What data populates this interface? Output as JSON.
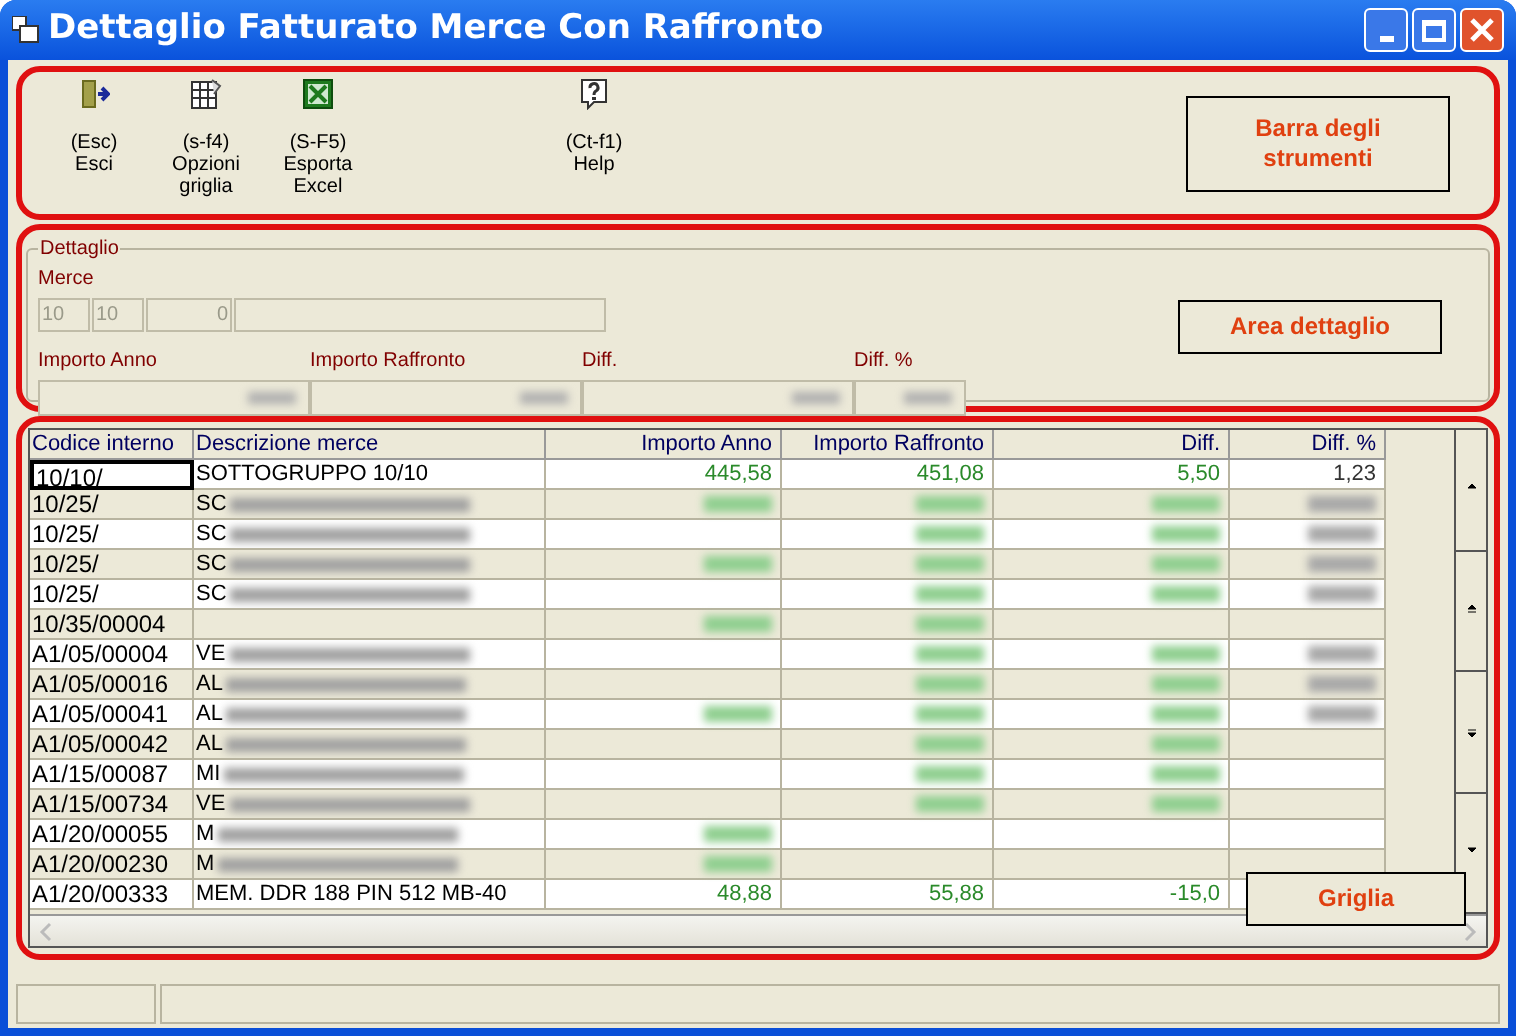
{
  "window": {
    "title": "Dettaglio Fatturato Merce Con Raffronto"
  },
  "toolbar": {
    "buttons": [
      {
        "kind": "exit",
        "shortcut": "(Esc)",
        "label": "Esci"
      },
      {
        "kind": "grid",
        "shortcut": "(s-f4)",
        "label": "Opzioni griglia"
      },
      {
        "kind": "excel",
        "shortcut": "(S-F5)",
        "label": "Esporta Excel"
      },
      {
        "kind": "help",
        "shortcut": "(Ct-f1)",
        "label": "Help"
      }
    ],
    "callout": "Barra degli strumenti"
  },
  "detail": {
    "title": "Dettaglio",
    "merce_label": "Merce",
    "merce_fields": [
      "10",
      "10",
      "0"
    ],
    "fields": [
      {
        "label": "Importo Anno",
        "blurred": true
      },
      {
        "label": "Importo Raffronto",
        "blurred": true
      },
      {
        "label": "Diff.",
        "blurred": true
      },
      {
        "label": "Diff. %",
        "blurred": true
      }
    ],
    "callout": "Area dettaglio"
  },
  "grid": {
    "columns": [
      "Codice interno",
      "Descrizione merce",
      "Importo Anno",
      "Importo Raffronto",
      "Diff.",
      "Diff. %"
    ],
    "rows": [
      {
        "selected": true,
        "code": "10/10/",
        "desc": "SOTTOGRUPPO 10/10",
        "desc_blurred": false,
        "values": [
          {
            "text": "445,58",
            "blurred": false
          },
          {
            "text": "451,08",
            "blurred": false
          },
          {
            "text": "5,50",
            "blurred": false
          },
          {
            "text": "1,23",
            "blurred": false
          }
        ]
      },
      {
        "selected": false,
        "code": "10/25/",
        "desc": "SC",
        "desc_blurred": true,
        "values": [
          {
            "blurred": true
          },
          {
            "blurred": true
          },
          {
            "blurred": true
          },
          {
            "blurred": true
          }
        ]
      },
      {
        "selected": false,
        "code": "10/25/",
        "desc": "SC",
        "desc_blurred": true,
        "values": [
          {
            "blurred": false
          },
          {
            "blurred": true
          },
          {
            "blurred": true
          },
          {
            "blurred": true
          }
        ]
      },
      {
        "selected": false,
        "code": "10/25/",
        "desc": "SC",
        "desc_blurred": true,
        "values": [
          {
            "blurred": true
          },
          {
            "blurred": true
          },
          {
            "blurred": true
          },
          {
            "blurred": true
          }
        ]
      },
      {
        "selected": false,
        "code": "10/25/",
        "desc": "SC",
        "desc_blurred": true,
        "values": [
          {
            "blurred": false
          },
          {
            "blurred": true
          },
          {
            "blurred": true
          },
          {
            "blurred": true
          }
        ]
      },
      {
        "selected": false,
        "code": "10/35/00004",
        "desc_blurred": false,
        "values": [
          {
            "blurred": true
          },
          {
            "blurred": true
          },
          {
            "blurred": false
          },
          {
            "blurred": false
          }
        ]
      },
      {
        "selected": false,
        "code": "A1/05/00004",
        "desc": "VE",
        "desc_blurred": true,
        "values": [
          {
            "blurred": false
          },
          {
            "blurred": true
          },
          {
            "blurred": true
          },
          {
            "blurred": true
          }
        ]
      },
      {
        "selected": false,
        "code": "A1/05/00016",
        "desc": "AL",
        "desc_blurred": true,
        "values": [
          {
            "blurred": false
          },
          {
            "blurred": true
          },
          {
            "blurred": true
          },
          {
            "blurred": true
          }
        ]
      },
      {
        "selected": false,
        "code": "A1/05/00041",
        "desc": "AL",
        "desc_blurred": true,
        "values": [
          {
            "blurred": true
          },
          {
            "blurred": true
          },
          {
            "blurred": true
          },
          {
            "blurred": true
          }
        ]
      },
      {
        "selected": false,
        "code": "A1/05/00042",
        "desc": "AL",
        "desc_blurred": true,
        "values": [
          {
            "blurred": false
          },
          {
            "blurred": true
          },
          {
            "blurred": true
          },
          {
            "blurred": false
          }
        ]
      },
      {
        "selected": false,
        "code": "A1/15/00087",
        "desc": "MI",
        "desc_blurred": true,
        "values": [
          {
            "blurred": false
          },
          {
            "blurred": true
          },
          {
            "blurred": true
          },
          {
            "blurred": false
          }
        ]
      },
      {
        "selected": false,
        "code": "A1/15/00734",
        "desc": "VE",
        "desc_blurred": true,
        "values": [
          {
            "blurred": false
          },
          {
            "blurred": true
          },
          {
            "blurred": true
          },
          {
            "blurred": false
          }
        ]
      },
      {
        "selected": false,
        "code": "A1/20/00055",
        "desc": "M",
        "desc_blurred": true,
        "values": [
          {
            "blurred": true
          },
          {
            "blurred": false
          },
          {
            "blurred": false
          },
          {
            "blurred": false
          }
        ]
      },
      {
        "selected": false,
        "code": "A1/20/00230",
        "desc": "M",
        "desc_blurred": true,
        "values": [
          {
            "blurred": true
          },
          {
            "blurred": false
          },
          {
            "blurred": false
          },
          {
            "blurred": false
          }
        ]
      },
      {
        "selected": false,
        "code": "A1/20/00333",
        "desc": "MEM. DDR 188 PIN 512 MB-40",
        "desc_blurred": false,
        "values": [
          {
            "text": "48,88",
            "blurred": false
          },
          {
            "text": "55,88",
            "blurred": false
          },
          {
            "text": "-15,0",
            "blurred": false
          }
        ]
      }
    ],
    "callout": "Griglia"
  }
}
